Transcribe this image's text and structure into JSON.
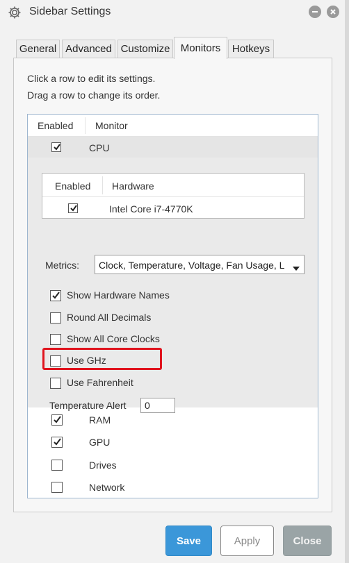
{
  "window": {
    "title": "Sidebar Settings",
    "icon": "gear-icon",
    "controls": [
      "minimize-icon",
      "close-icon"
    ]
  },
  "tabs": [
    {
      "label": "General"
    },
    {
      "label": "Advanced"
    },
    {
      "label": "Customize"
    },
    {
      "label": "Monitors",
      "active": true
    },
    {
      "label": "Hotkeys"
    }
  ],
  "help": {
    "line1": "Click a row to edit its settings.",
    "line2": "Drag a row to change its order."
  },
  "monitor_list": {
    "headers": {
      "enabled": "Enabled",
      "monitor": "Monitor"
    },
    "cpu": {
      "label": "CPU",
      "enabled": true,
      "hardware_table": {
        "headers": {
          "enabled": "Enabled",
          "hardware": "Hardware"
        },
        "rows": [
          {
            "enabled": true,
            "name": "Intel Core i7-4770K"
          }
        ]
      },
      "metrics": {
        "label": "Metrics:",
        "value": "Clock, Temperature, Voltage, Fan Usage, L"
      },
      "options": [
        {
          "label": "Show Hardware Names",
          "checked": true
        },
        {
          "label": "Round All Decimals",
          "checked": false
        },
        {
          "label": "Show All Core Clocks",
          "checked": false
        },
        {
          "label": "Use GHz",
          "checked": false
        },
        {
          "label": "Use Fahrenheit",
          "checked": false,
          "highlighted": true
        }
      ],
      "temperature_alert": {
        "label": "Temperature Alert",
        "value": "0"
      }
    },
    "others": [
      {
        "label": "RAM",
        "enabled": true
      },
      {
        "label": "GPU",
        "enabled": true
      },
      {
        "label": "Drives",
        "enabled": false
      },
      {
        "label": "Network",
        "enabled": false
      }
    ]
  },
  "buttons": {
    "save": "Save",
    "apply": "Apply",
    "close": "Close"
  },
  "colors": {
    "accent": "#3b97d9",
    "highlight": "#e0141e",
    "close_btn": "#9aa4a6"
  }
}
